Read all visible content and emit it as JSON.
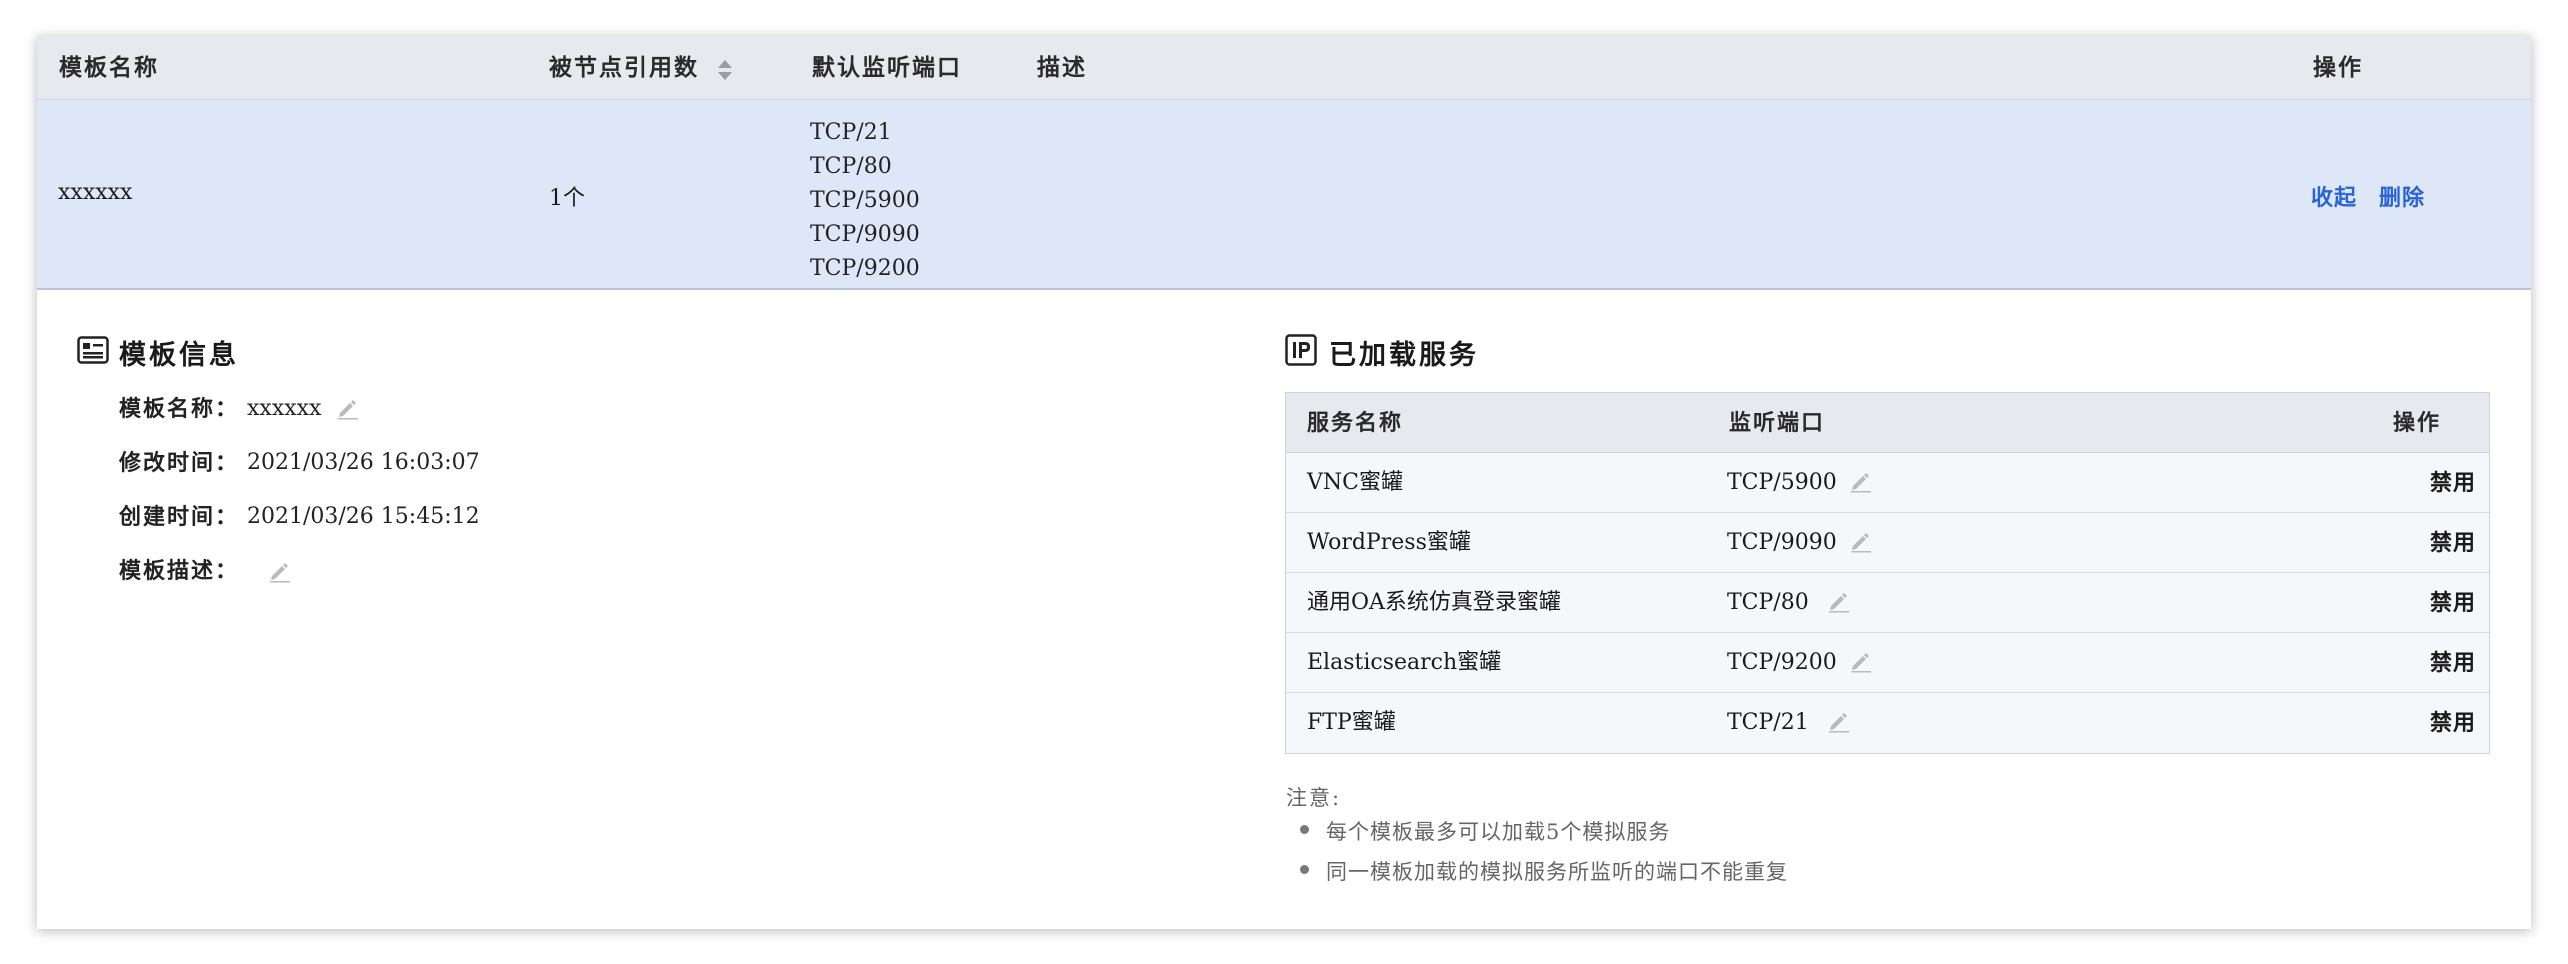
{
  "table": {
    "headers": {
      "name": "模板名称",
      "refs": "被节点引用数",
      "ports": "默认监听端口",
      "desc": "描述",
      "ops": "操作"
    },
    "row": {
      "name": "xxxxxx",
      "refs": "1个",
      "ports": [
        "TCP/21",
        "TCP/80",
        "TCP/5900",
        "TCP/9090",
        "TCP/9200"
      ],
      "desc": "",
      "collapse": "收起",
      "delete": "删除"
    }
  },
  "template_info": {
    "title": "模板信息",
    "fields": [
      {
        "label": "模板名称：",
        "value": "xxxxxx"
      },
      {
        "label": "修改时间：",
        "value": "2021/03/26 16:03:07"
      },
      {
        "label": "创建时间：",
        "value": "2021/03/26 15:45:12"
      },
      {
        "label": "模板描述：",
        "value": ""
      }
    ]
  },
  "services": {
    "title": "已加载服务",
    "headers": {
      "name": "服务名称",
      "port": "监听端口",
      "op": "操作"
    },
    "rows": [
      {
        "name": "VNC蜜罐",
        "port": "TCP/5900",
        "action": "禁用"
      },
      {
        "name": "WordPress蜜罐",
        "port": "TCP/9090",
        "action": "禁用"
      },
      {
        "name": "通用OA系统仿真登录蜜罐",
        "port": "TCP/80",
        "action": "禁用"
      },
      {
        "name": "Elasticsearch蜜罐",
        "port": "TCP/9200",
        "action": "禁用"
      },
      {
        "name": "FTP蜜罐",
        "port": "TCP/21",
        "action": "禁用"
      }
    ]
  },
  "notes": {
    "title": "注意:",
    "items": [
      "每个模板最多可以加载5个模拟服务",
      "同一模板加载的模拟服务所监听的端口不能重复"
    ]
  },
  "colors": {
    "link": "#2a63d6",
    "row_highlight": "#dde7f8",
    "header_bg": "#e8e9ee"
  },
  "icons": {
    "sort": "sort-icon",
    "info": "id-card-icon",
    "ip": "ip-icon",
    "edit": "pencil-icon"
  }
}
